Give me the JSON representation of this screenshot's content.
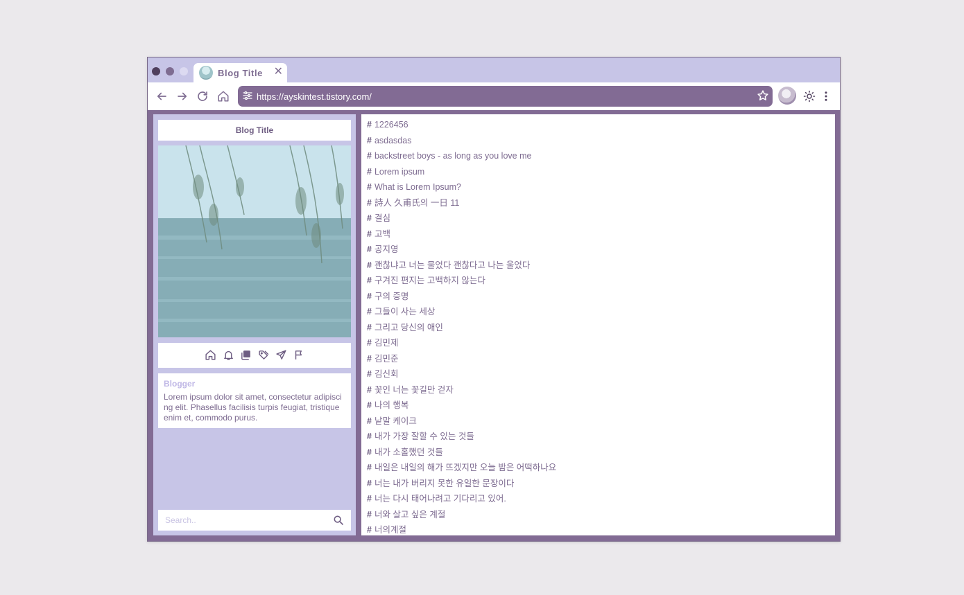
{
  "window": {
    "tab_title": "Blog Title",
    "tab_close": "✕",
    "url": "https://ayskintest.tistory.com/"
  },
  "toolbar": {
    "icons": [
      "back-arrow-icon",
      "forward-arrow-icon",
      "reload-icon",
      "home-icon",
      "tune-icon",
      "star-icon",
      "avatar",
      "theme-sun-icon",
      "more-vert-icon"
    ]
  },
  "sidebar": {
    "blog_title": "Blog Title",
    "icons": [
      "home-icon",
      "bell-icon",
      "copy-icon",
      "tags-icon",
      "send-icon",
      "flag-icon"
    ],
    "about_title": "Blogger",
    "about_text": "Lorem ipsum dolor sit amet, consectetur adipiscing elit. Phasellus facilisis turpis feugiat, tristique enim et, commodo purus.",
    "search_placeholder": "Search.."
  },
  "main": {
    "hash": "#",
    "tags": [
      "1226456",
      "asdasdas",
      "backstreet boys - as long as you love me",
      "Lorem ipsum",
      "What is Lorem Ipsum?",
      "詩人 久甫氏의 一日 11",
      "결심",
      "고백",
      "공지영",
      "괜찮냐고 너는 물었다 괜찮다고 나는 울었다",
      "구겨진 편지는 고백하지 않는다",
      "구의 증명",
      "그들이 사는 세상",
      "그리고 당신의 애인",
      "김민제",
      "김민준",
      "김신회",
      "꽃인 너는 꽃길만 걷자",
      "나의 행복",
      "낱말 케이크",
      "내가 가장 잘할 수 있는 것들",
      "내가 소홀했던 것들",
      "내일은 내일의 해가 뜨겠지만 오늘 밤은 어떡하나요",
      "너는 내가 버리지 못한 유일한 문장이다",
      "너는 다시 태어나려고 기다리고 있어.",
      "너와 살고 싶은 계절",
      "너의계절"
    ]
  }
}
